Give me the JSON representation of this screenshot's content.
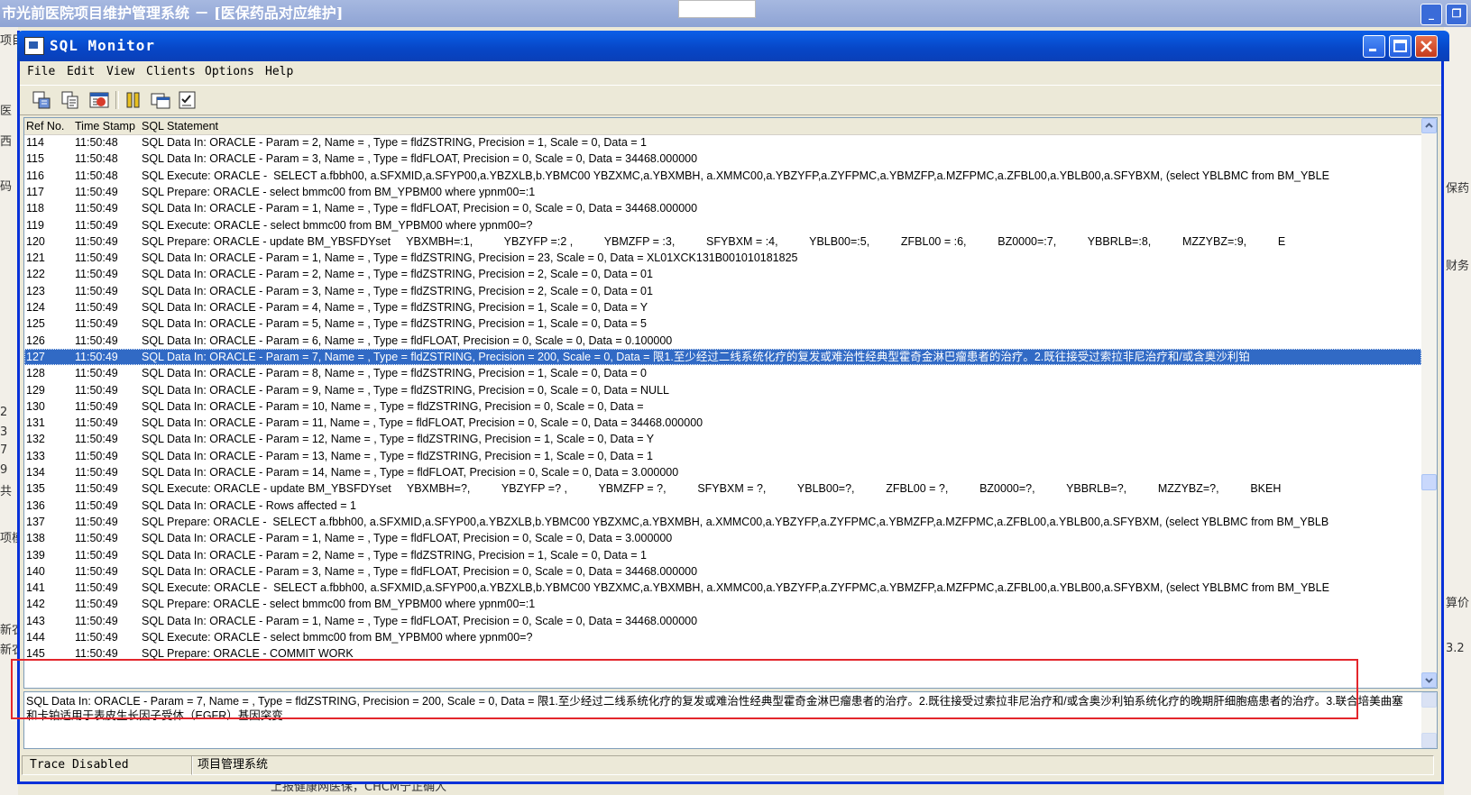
{
  "background_app": {
    "title": "市光前医院项目维护管理系统 － [医保药品对应维护]",
    "left_fragments": [
      "项目",
      "医",
      "西",
      "码",
      "2",
      "3",
      "7",
      "9",
      "共",
      "项模",
      "新农",
      "新农"
    ],
    "right_fragments": [
      "保药",
      "财务",
      "算价",
      "3.2"
    ],
    "bottom_text": "上报健康网医保，CHCM宁正确人"
  },
  "window": {
    "title": "SQL Monitor",
    "menu": [
      "File",
      "Edit",
      "View",
      "Clients",
      "Options",
      "Help"
    ],
    "toolbar_icons": [
      "save-log-icon",
      "copy-icon",
      "clear-icon",
      "pause-icon",
      "window-icon",
      "checklist-icon"
    ]
  },
  "list": {
    "columns": [
      "Ref No.",
      "Time Stamp",
      "SQL Statement"
    ],
    "selected_ref": "127",
    "rows": [
      {
        "ref": "114",
        "time": "11:50:48",
        "stmt": "SQL Data In: ORACLE - Param = 2, Name = , Type = fldZSTRING, Precision = 1, Scale = 0, Data = 1"
      },
      {
        "ref": "115",
        "time": "11:50:48",
        "stmt": "SQL Data In: ORACLE - Param = 3, Name = , Type = fldFLOAT, Precision = 0, Scale = 0, Data = 34468.000000"
      },
      {
        "ref": "116",
        "time": "11:50:48",
        "stmt": "SQL Execute: ORACLE -  SELECT a.fbbh00, a.SFXMID,a.SFYP00,a.YBZXLB,b.YBMC00 YBZXMC,a.YBXMBH, a.XMMC00,a.YBZYFP,a.ZYFPMC,a.YBMZFP,a.MZFPMC,a.ZFBL00,a.YBLB00,a.SFYBXM, (select YBLBMC from BM_YBLE"
      },
      {
        "ref": "117",
        "time": "11:50:49",
        "stmt": "SQL Prepare: ORACLE - select bmmc00 from BM_YPBM00 where ypnm00=:1"
      },
      {
        "ref": "118",
        "time": "11:50:49",
        "stmt": "SQL Data In: ORACLE - Param = 1, Name = , Type = fldFLOAT, Precision = 0, Scale = 0, Data = 34468.000000"
      },
      {
        "ref": "119",
        "time": "11:50:49",
        "stmt": "SQL Execute: ORACLE - select bmmc00 from BM_YPBM00 where ypnm00=?"
      },
      {
        "ref": "120",
        "time": "11:50:49",
        "stmt": "SQL Prepare: ORACLE - update BM_YBSFDYset     YBXMBH=:1,          YBZYFP =:2 ,          YBMZFP = :3,          SFYBXM = :4,          YBLB00=:5,          ZFBL00 = :6,          BZ0000=:7,          YBBRLB=:8,          MZZYBZ=:9,          E"
      },
      {
        "ref": "121",
        "time": "11:50:49",
        "stmt": "SQL Data In: ORACLE - Param = 1, Name = , Type = fldZSTRING, Precision = 23, Scale = 0, Data = XL01XCK131B001010181825"
      },
      {
        "ref": "122",
        "time": "11:50:49",
        "stmt": "SQL Data In: ORACLE - Param = 2, Name = , Type = fldZSTRING, Precision = 2, Scale = 0, Data = 01"
      },
      {
        "ref": "123",
        "time": "11:50:49",
        "stmt": "SQL Data In: ORACLE - Param = 3, Name = , Type = fldZSTRING, Precision = 2, Scale = 0, Data = 01"
      },
      {
        "ref": "124",
        "time": "11:50:49",
        "stmt": "SQL Data In: ORACLE - Param = 4, Name = , Type = fldZSTRING, Precision = 1, Scale = 0, Data = Y"
      },
      {
        "ref": "125",
        "time": "11:50:49",
        "stmt": "SQL Data In: ORACLE - Param = 5, Name = , Type = fldZSTRING, Precision = 1, Scale = 0, Data = 5"
      },
      {
        "ref": "126",
        "time": "11:50:49",
        "stmt": "SQL Data In: ORACLE - Param = 6, Name = , Type = fldFLOAT, Precision = 0, Scale = 0, Data = 0.100000"
      },
      {
        "ref": "127",
        "time": "11:50:49",
        "stmt": "SQL Data In: ORACLE - Param = 7, Name = , Type = fldZSTRING, Precision = 200, Scale = 0, Data = 限1.至少经过二线系统化疗的复发或难治性经典型霍奇金淋巴瘤患者的治疗。2.既往接受过索拉非尼治疗和/或含奥沙利铂"
      },
      {
        "ref": "128",
        "time": "11:50:49",
        "stmt": "SQL Data In: ORACLE - Param = 8, Name = , Type = fldZSTRING, Precision = 1, Scale = 0, Data = 0"
      },
      {
        "ref": "129",
        "time": "11:50:49",
        "stmt": "SQL Data In: ORACLE - Param = 9, Name = , Type = fldZSTRING, Precision = 0, Scale = 0, Data = NULL"
      },
      {
        "ref": "130",
        "time": "11:50:49",
        "stmt": "SQL Data In: ORACLE - Param = 10, Name = , Type = fldZSTRING, Precision = 0, Scale = 0, Data ="
      },
      {
        "ref": "131",
        "time": "11:50:49",
        "stmt": "SQL Data In: ORACLE - Param = 11, Name = , Type = fldFLOAT, Precision = 0, Scale = 0, Data = 34468.000000"
      },
      {
        "ref": "132",
        "time": "11:50:49",
        "stmt": "SQL Data In: ORACLE - Param = 12, Name = , Type = fldZSTRING, Precision = 1, Scale = 0, Data = Y"
      },
      {
        "ref": "133",
        "time": "11:50:49",
        "stmt": "SQL Data In: ORACLE - Param = 13, Name = , Type = fldZSTRING, Precision = 1, Scale = 0, Data = 1"
      },
      {
        "ref": "134",
        "time": "11:50:49",
        "stmt": "SQL Data In: ORACLE - Param = 14, Name = , Type = fldFLOAT, Precision = 0, Scale = 0, Data = 3.000000"
      },
      {
        "ref": "135",
        "time": "11:50:49",
        "stmt": "SQL Execute: ORACLE - update BM_YBSFDYset     YBXMBH=?,          YBZYFP =? ,          YBMZFP = ?,          SFYBXM = ?,          YBLB00=?,          ZFBL00 = ?,          BZ0000=?,          YBBRLB=?,          MZZYBZ=?,          BKEH"
      },
      {
        "ref": "136",
        "time": "11:50:49",
        "stmt": "SQL Data In: ORACLE - Rows affected = 1"
      },
      {
        "ref": "137",
        "time": "11:50:49",
        "stmt": "SQL Prepare: ORACLE -  SELECT a.fbbh00, a.SFXMID,a.SFYP00,a.YBZXLB,b.YBMC00 YBZXMC,a.YBXMBH, a.XMMC00,a.YBZYFP,a.ZYFPMC,a.YBMZFP,a.MZFPMC,a.ZFBL00,a.YBLB00,a.SFYBXM, (select YBLBMC from BM_YBLB"
      },
      {
        "ref": "138",
        "time": "11:50:49",
        "stmt": "SQL Data In: ORACLE - Param = 1, Name = , Type = fldFLOAT, Precision = 0, Scale = 0, Data = 3.000000"
      },
      {
        "ref": "139",
        "time": "11:50:49",
        "stmt": "SQL Data In: ORACLE - Param = 2, Name = , Type = fldZSTRING, Precision = 1, Scale = 0, Data = 1"
      },
      {
        "ref": "140",
        "time": "11:50:49",
        "stmt": "SQL Data In: ORACLE - Param = 3, Name = , Type = fldFLOAT, Precision = 0, Scale = 0, Data = 34468.000000"
      },
      {
        "ref": "141",
        "time": "11:50:49",
        "stmt": "SQL Execute: ORACLE -  SELECT a.fbbh00, a.SFXMID,a.SFYP00,a.YBZXLB,b.YBMC00 YBZXMC,a.YBXMBH, a.XMMC00,a.YBZYFP,a.ZYFPMC,a.YBMZFP,a.MZFPMC,a.ZFBL00,a.YBLB00,a.SFYBXM, (select YBLBMC from BM_YBLE"
      },
      {
        "ref": "142",
        "time": "11:50:49",
        "stmt": "SQL Prepare: ORACLE - select bmmc00 from BM_YPBM00 where ypnm00=:1"
      },
      {
        "ref": "143",
        "time": "11:50:49",
        "stmt": "SQL Data In: ORACLE - Param = 1, Name = , Type = fldFLOAT, Precision = 0, Scale = 0, Data = 34468.000000"
      },
      {
        "ref": "144",
        "time": "11:50:49",
        "stmt": "SQL Execute: ORACLE - select bmmc00 from BM_YPBM00 where ypnm00=?"
      },
      {
        "ref": "145",
        "time": "11:50:49",
        "stmt": "SQL Prepare: ORACLE - COMMIT WORK"
      }
    ]
  },
  "detail": {
    "text": "SQL Data In: ORACLE - Param = 7, Name = , Type = fldZSTRING, Precision = 200, Scale = 0, Data = 限1.至少经过二线系统化疗的复发或难治性经典型霍奇金淋巴瘤患者的治疗。2.既往接受过索拉非尼治疗和/或含奥沙利铂系统化疗的晚期肝细胞癌患者的治疗。3.联合培美曲塞和卡铂适用于表皮生长因子受体（EGFR）基因突变"
  },
  "status": {
    "trace": "Trace Disabled",
    "client": "项目管理系统"
  },
  "colors": {
    "selection": "#316ac5",
    "title_blue": "#0746c6",
    "highlight_frame": "#e3262c"
  }
}
